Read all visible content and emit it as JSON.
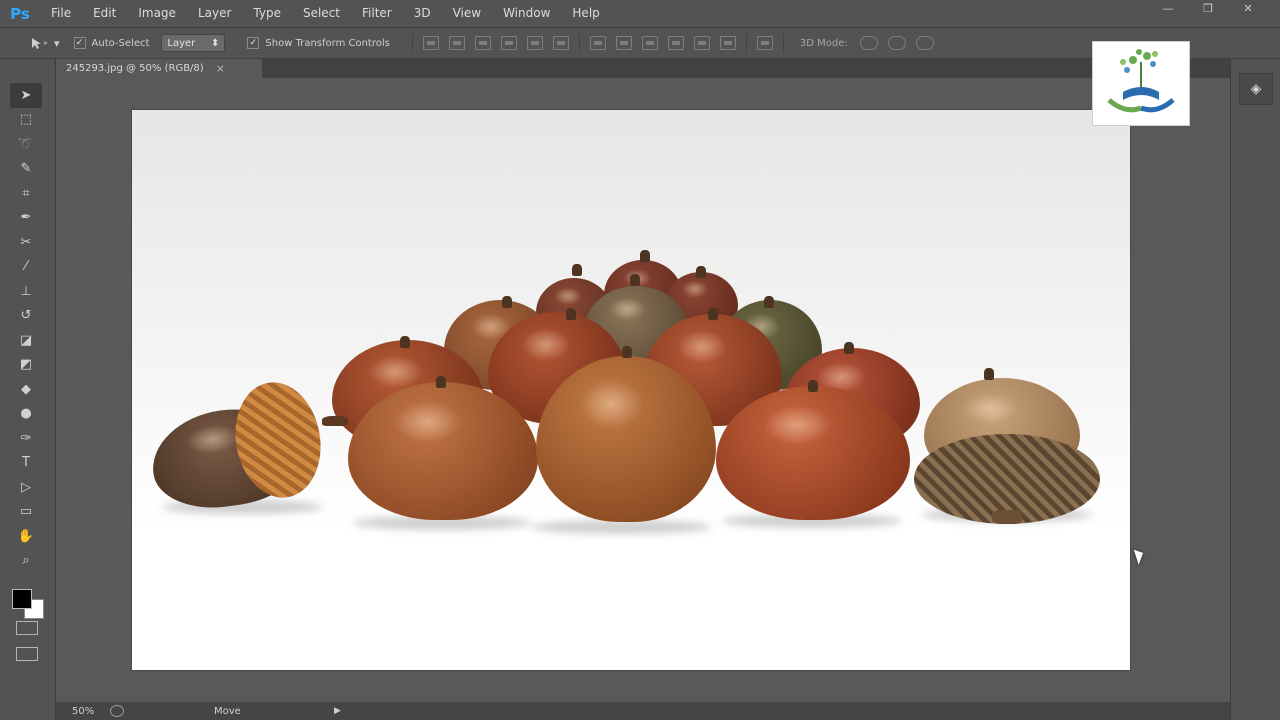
{
  "app": {
    "logo": "Ps"
  },
  "menu": {
    "items": [
      "File",
      "Edit",
      "Image",
      "Layer",
      "Type",
      "Select",
      "Filter",
      "3D",
      "View",
      "Window",
      "Help"
    ]
  },
  "window_controls": {
    "minimize": "—",
    "maximize": "❐",
    "close": "✕"
  },
  "options_bar": {
    "auto_select_label": "Auto-Select",
    "auto_select_checked": true,
    "layer_dropdown": "Layer",
    "show_transform_label": "Show Transform Controls",
    "show_transform_checked": true,
    "mode_3d_label": "3D Mode:"
  },
  "document": {
    "tab_title": "245293.jpg @ 50% (RGB/8)",
    "tab_close": "×"
  },
  "status_bar": {
    "zoom": "50%",
    "info": "Move",
    "arrow": "▶"
  },
  "tools": [
    "move-tool",
    "marquee-tool",
    "lasso-tool",
    "quick-select-tool",
    "crop-tool",
    "eyedropper-tool",
    "healing-brush-tool",
    "brush-tool",
    "clone-stamp-tool",
    "history-brush-tool",
    "eraser-tool",
    "paint-bucket-tool",
    "blur-tool",
    "dodge-tool",
    "pen-tool",
    "type-tool",
    "path-selection-tool",
    "rectangle-tool",
    "hand-tool",
    "zoom-tool"
  ],
  "colors": {
    "foreground": "#000000",
    "background": "#ffffff",
    "ui_bg": "#535353",
    "ps_blue": "#31a8ff"
  }
}
